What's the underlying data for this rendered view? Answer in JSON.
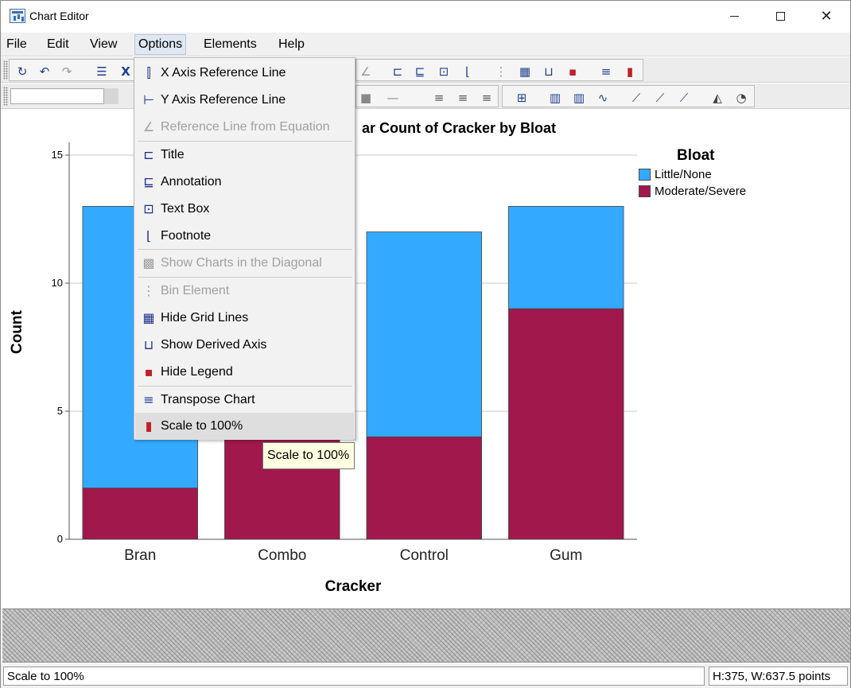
{
  "window": {
    "title": "Chart Editor"
  },
  "menubar": {
    "items": [
      "File",
      "Edit",
      "View",
      "Options",
      "Elements",
      "Help"
    ],
    "active": "Options"
  },
  "options_menu": {
    "items": [
      {
        "label": "X Axis Reference Line",
        "icon": "x-axis-reference-line-icon",
        "enabled": true
      },
      {
        "label": "Y Axis Reference Line",
        "icon": "y-axis-reference-line-icon",
        "enabled": true
      },
      {
        "label": "Reference Line from Equation",
        "icon": "equation-line-icon",
        "enabled": false
      },
      {
        "label": "Title",
        "icon": "title-icon",
        "enabled": true
      },
      {
        "label": "Annotation",
        "icon": "annotation-icon",
        "enabled": true
      },
      {
        "label": "Text Box",
        "icon": "text-box-icon",
        "enabled": true
      },
      {
        "label": "Footnote",
        "icon": "footnote-icon",
        "enabled": true
      },
      {
        "label": "Show Charts in the Diagonal",
        "icon": "diagonal-charts-icon",
        "enabled": false
      },
      {
        "label": "Bin Element",
        "icon": "bin-element-icon",
        "enabled": false
      },
      {
        "label": "Hide Grid Lines",
        "icon": "grid-lines-icon",
        "enabled": true
      },
      {
        "label": "Show Derived Axis",
        "icon": "derived-axis-icon",
        "enabled": true
      },
      {
        "label": "Hide Legend",
        "icon": "legend-icon",
        "enabled": true
      },
      {
        "label": "Transpose Chart",
        "icon": "transpose-icon",
        "enabled": true
      },
      {
        "label": "Scale to 100%",
        "icon": "scale-100-icon",
        "enabled": true,
        "highlighted": true
      }
    ]
  },
  "tooltip": {
    "text": "Scale to 100%"
  },
  "legend": {
    "title": "Bloat",
    "entries": [
      {
        "label": "Little/None",
        "color": "#33aaff"
      },
      {
        "label": "Moderate/Severe",
        "color": "#a0184c"
      }
    ]
  },
  "chart_data": {
    "type": "bar",
    "stacked": true,
    "title": "Stacked Bar Count of Cracker by Bloat",
    "visible_title": "ar Count of Cracker by Bloat",
    "xlabel": "Cracker",
    "ylabel": "Count",
    "categories": [
      "Bran",
      "Combo",
      "Control",
      "Gum"
    ],
    "series": [
      {
        "name": "Moderate/Severe",
        "color": "#a0184c",
        "values": [
          2,
          4,
          4,
          9
        ]
      },
      {
        "name": "Little/None",
        "color": "#33aaff",
        "values": [
          11,
          9,
          8,
          4
        ]
      }
    ],
    "ylim": [
      0,
      15
    ],
    "yticks": [
      0,
      5,
      10,
      15
    ],
    "grid": true,
    "legend_position": "right"
  },
  "statusbar": {
    "left": "Scale to 100%",
    "right": "H:375, W:637.5 points"
  }
}
